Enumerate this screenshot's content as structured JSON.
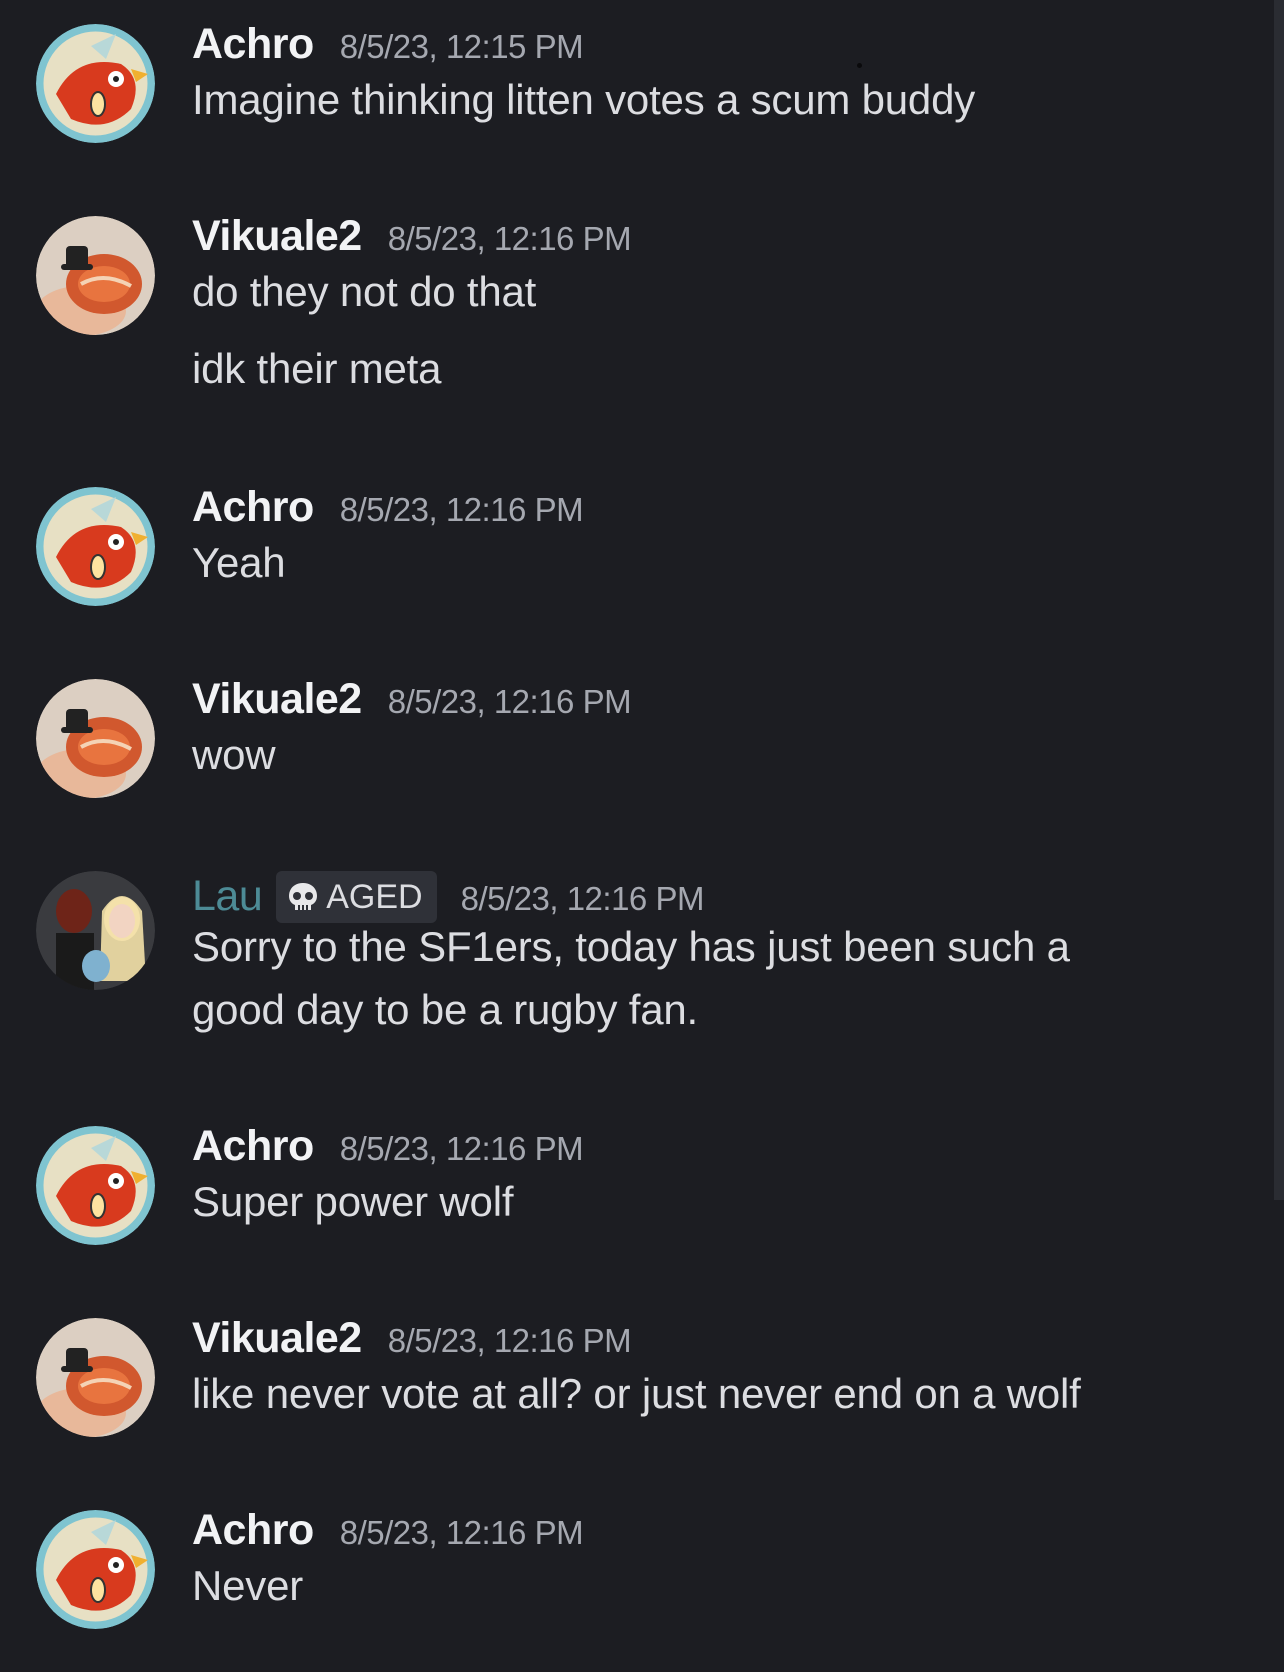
{
  "messages": [
    {
      "author": "Achro",
      "avatar": "magikarp-avatar",
      "timestamp": "8/5/23, 12:15 PM",
      "lines": [
        "Imagine thinking litten votes a scum buddy"
      ]
    },
    {
      "author": "Vikuale2",
      "avatar": "snake-avatar",
      "timestamp": "8/5/23, 12:16 PM",
      "lines": [
        "do they not do that",
        "idk their meta"
      ]
    },
    {
      "author": "Achro",
      "avatar": "magikarp-avatar",
      "timestamp": "8/5/23, 12:16 PM",
      "lines": [
        "Yeah"
      ]
    },
    {
      "author": "Vikuale2",
      "avatar": "snake-avatar",
      "timestamp": "8/5/23, 12:16 PM",
      "lines": [
        "wow"
      ]
    },
    {
      "author": "Lau",
      "badge": "AGED",
      "badge_icon": "skull-icon",
      "avatar": "collage-avatar",
      "timestamp": "8/5/23, 12:16 PM",
      "lines": [
        "Sorry to the SF1ers, today has just been such a",
        "good day to be a rugby fan."
      ]
    },
    {
      "author": "Achro",
      "avatar": "magikarp-avatar",
      "timestamp": "8/5/23, 12:16 PM",
      "lines": [
        "Super power wolf"
      ]
    },
    {
      "author": "Vikuale2",
      "avatar": "snake-avatar",
      "timestamp": "8/5/23, 12:16 PM",
      "lines": [
        "like never vote at all? or just never end on a wolf"
      ]
    },
    {
      "author": "Achro",
      "avatar": "magikarp-avatar",
      "timestamp": "8/5/23, 12:16 PM",
      "lines": [
        "Never"
      ]
    }
  ],
  "colors": {
    "background": "#1c1d22",
    "username": "#f2f3f5",
    "username_role": "#4d8b96",
    "timestamp": "#a5a8b0",
    "text": "#dcdde1"
  }
}
